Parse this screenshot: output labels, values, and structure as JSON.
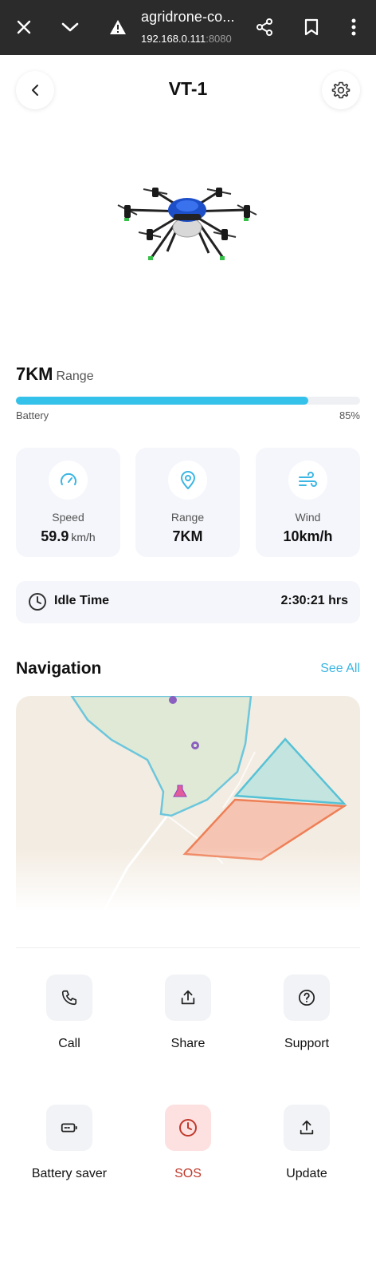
{
  "browser": {
    "title": "agridrone-co...",
    "url_host": "192.168.0.111",
    "url_port": ":8080"
  },
  "header": {
    "title": "VT-1"
  },
  "range": {
    "value": "7KM",
    "unit": "Range"
  },
  "battery": {
    "label": "Battery",
    "percent_text": "85%",
    "level": 0.85
  },
  "stats": [
    {
      "icon": "speedometer-icon",
      "label": "Speed",
      "value": "59.9",
      "unit": "km/h"
    },
    {
      "icon": "map-pin-icon",
      "label": "Range",
      "value": "7KM",
      "unit": ""
    },
    {
      "icon": "wind-icon",
      "label": "Wind",
      "value": "10km/h",
      "unit": ""
    }
  ],
  "idle": {
    "label": "Idle Time",
    "value": "2:30:21 hrs"
  },
  "navigation": {
    "title": "Navigation",
    "see_all": "See All"
  },
  "actions": [
    {
      "icon": "phone-icon",
      "label": "Call"
    },
    {
      "icon": "share-icon",
      "label": "Share"
    },
    {
      "icon": "help-circle-icon",
      "label": "Support"
    },
    {
      "icon": "battery-icon",
      "label": "Battery saver"
    },
    {
      "icon": "clock-icon",
      "label": "SOS"
    },
    {
      "icon": "upload-icon",
      "label": "Update"
    }
  ],
  "colors": {
    "accent": "#34c2ea",
    "link": "#3bb6e3",
    "sos": "#c0392b",
    "sos_bg": "#fde1e1",
    "card_bg": "#f5f6fb"
  }
}
